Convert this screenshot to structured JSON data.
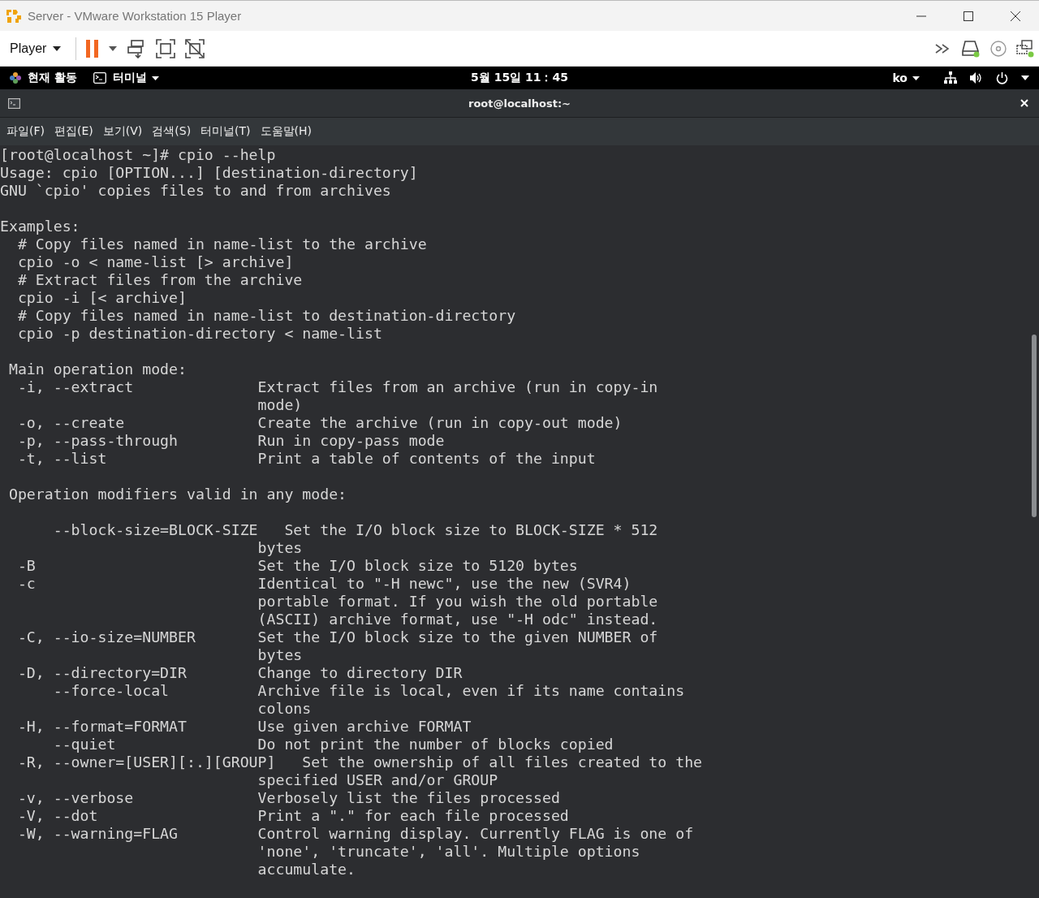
{
  "window": {
    "title": "Server - VMware Workstation 15 Player"
  },
  "toolbar": {
    "player_menu": "Player"
  },
  "top_bar": {
    "activities": "현재 활동",
    "app_menu": "터미널",
    "clock": "5월 15일  11：45",
    "language": "ko"
  },
  "terminal": {
    "title": "root@localhost:~",
    "menus": [
      "파일(F)",
      "편집(E)",
      "보기(V)",
      "검색(S)",
      "터미널(T)",
      "도움말(H)"
    ],
    "blocks": [
      [
        "[root@localhost ~]# cpio --help",
        "Usage: cpio [OPTION...] [destination-directory]",
        "GNU `cpio' copies files to and from archives"
      ],
      [
        "Examples:",
        "  # Copy files named in name-list to the archive",
        "  cpio -o < name-list [> archive]",
        "  # Extract files from the archive",
        "  cpio -i [< archive]",
        "  # Copy files named in name-list to destination-directory",
        "  cpio -p destination-directory < name-list"
      ],
      [
        " Main operation mode:",
        "  -i, --extract              Extract files from an archive (run in copy-in",
        "                             mode)",
        "  -o, --create               Create the archive (run in copy-out mode)",
        "  -p, --pass-through         Run in copy-pass mode",
        "  -t, --list                 Print a table of contents of the input"
      ],
      [
        " Operation modifiers valid in any mode:"
      ],
      [
        "      --block-size=BLOCK-SIZE   Set the I/O block size to BLOCK-SIZE * 512",
        "                             bytes",
        "  -B                         Set the I/O block size to 5120 bytes",
        "  -c                         Identical to \"-H newc\", use the new (SVR4)",
        "                             portable format. If you wish the old portable",
        "                             (ASCII) archive format, use \"-H odc\" instead.",
        "  -C, --io-size=NUMBER       Set the I/O block size to the given NUMBER of",
        "                             bytes",
        "  -D, --directory=DIR        Change to directory DIR",
        "      --force-local          Archive file is local, even if its name contains",
        "                             colons",
        "  -H, --format=FORMAT        Use given archive FORMAT",
        "      --quiet                Do not print the number of blocks copied",
        "  -R, --owner=[USER][:.][GROUP]   Set the ownership of all files created to the",
        "                             specified USER and/or GROUP",
        "  -v, --verbose              Verbosely list the files processed",
        "  -V, --dot                  Print a \".\" for each file processed",
        "  -W, --warning=FLAG         Control warning display. Currently FLAG is one of",
        "                             'none', 'truncate', 'all'. Multiple options",
        "                             accumulate."
      ]
    ]
  }
}
